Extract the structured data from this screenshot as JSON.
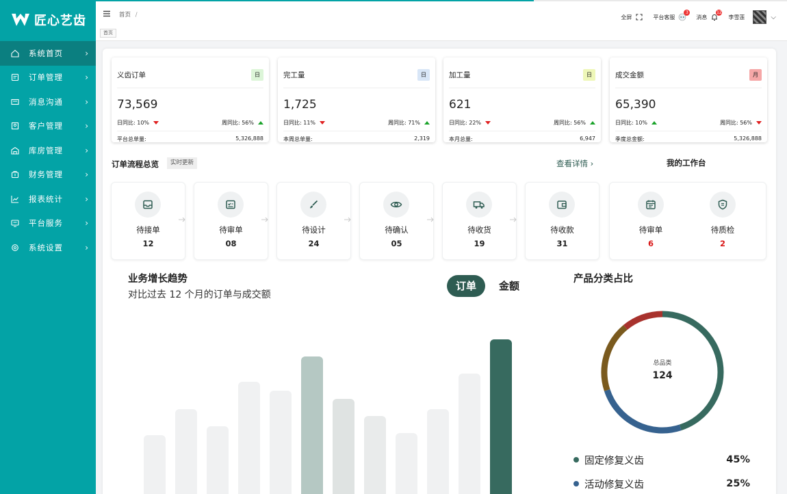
{
  "brand": {
    "name": "匠心艺齿"
  },
  "sidebar": {
    "items": [
      {
        "label": "系统首页",
        "icon": "home-icon",
        "active": true
      },
      {
        "label": "订单管理",
        "icon": "order-icon"
      },
      {
        "label": "消息沟通",
        "icon": "message-icon"
      },
      {
        "label": "客户管理",
        "icon": "customer-icon"
      },
      {
        "label": "库房管理",
        "icon": "warehouse-icon"
      },
      {
        "label": "财务管理",
        "icon": "finance-icon"
      },
      {
        "label": "报表统计",
        "icon": "report-icon"
      },
      {
        "label": "平台服务",
        "icon": "service-icon"
      },
      {
        "label": "系统设置",
        "icon": "settings-icon"
      }
    ]
  },
  "header": {
    "breadcrumb": "首页",
    "breadcrumb_sep": "/",
    "tab": "首页",
    "fullscreen": "全屏",
    "support": "平台客服",
    "support_badge": "3",
    "messages": "消息",
    "messages_badge": "12",
    "user": "李雪莲"
  },
  "stats": [
    {
      "title": "义齿订单",
      "badge": "日",
      "badge_color": "#dcf5d8",
      "value": "73,569",
      "day_label": "日同比:",
      "day_value": "10%",
      "day_trend": "down",
      "week_label": "周同比:",
      "week_value": "56%",
      "week_trend": "up",
      "foot_label": "平台总单量:",
      "foot_value": "5,326,888"
    },
    {
      "title": "完工量",
      "badge": "日",
      "badge_color": "#d8e6f7",
      "value": "1,725",
      "day_label": "日同比:",
      "day_value": "11%",
      "day_trend": "down",
      "week_label": "周同比:",
      "week_value": "71%",
      "week_trend": "up",
      "foot_label": "本周总单量:",
      "foot_value": "2,319"
    },
    {
      "title": "加工量",
      "badge": "日",
      "badge_color": "#eef7b8",
      "value": "621",
      "day_label": "日同比:",
      "day_value": "22%",
      "day_trend": "down",
      "week_label": "周同比:",
      "week_value": "56%",
      "week_trend": "up",
      "foot_label": "本月总量:",
      "foot_value": "6,947"
    },
    {
      "title": "成交金额",
      "badge": "月",
      "badge_color": "#f6a7a7",
      "value": "65,390",
      "day_label": "日同比:",
      "day_value": "10%",
      "day_trend": "up",
      "week_label": "周同比:",
      "week_value": "56%",
      "week_trend": "down",
      "foot_label": "季度总金额:",
      "foot_value": "5,326,888"
    }
  ],
  "flow": {
    "title": "订单流程总览",
    "tag": "实时更新",
    "detail_link": "查看详情 ›",
    "steps": [
      {
        "label": "待接单",
        "count": "12",
        "icon": "inbox-icon"
      },
      {
        "label": "待审单",
        "count": "08",
        "icon": "checklist-icon"
      },
      {
        "label": "待设计",
        "count": "24",
        "icon": "brush-icon"
      },
      {
        "label": "待确认",
        "count": "05",
        "icon": "eye-icon"
      },
      {
        "label": "待收货",
        "count": "19",
        "icon": "truck-icon"
      },
      {
        "label": "待收款",
        "count": "31",
        "icon": "wallet-icon"
      }
    ]
  },
  "workbench": {
    "title": "我的工作台",
    "items": [
      {
        "label": "待审单",
        "count": "6",
        "icon": "calendar-check-icon"
      },
      {
        "label": "待质检",
        "count": "2",
        "icon": "shield-icon"
      }
    ]
  },
  "trend": {
    "title": "业务增长趋势",
    "subtitle": "对比过去 12 个月的订单与成交额",
    "tab_orders": "订单",
    "tab_amount": "金额"
  },
  "chart_data": [
    {
      "type": "bar",
      "title": "业务增长趋势",
      "subtitle": "对比过去 12 个月的订单与成交额",
      "values": [
        38,
        53,
        43,
        69,
        64,
        84,
        59,
        49,
        39,
        53,
        74,
        94
      ],
      "highlight_color": "#376a5f",
      "mid_color": "#b5c8c3",
      "base_color": "#f0f1f2"
    },
    {
      "type": "pie",
      "title": "产品分类占比",
      "center_label": "总品类",
      "center_value": "124",
      "slices": [
        {
          "name": "固定修复义齿",
          "value": 45,
          "color": "#376a5f"
        },
        {
          "name": "活动修复义齿",
          "value": 25,
          "color": "#36628f"
        },
        {
          "value": 19,
          "color": "#7a5a1e"
        },
        {
          "value": 11,
          "color": "#a8322d"
        }
      ],
      "legend": [
        {
          "name": "固定修复义齿",
          "pct": "45%",
          "color": "#376a5f"
        },
        {
          "name": "活动修复义齿",
          "pct": "25%",
          "color": "#36628f"
        }
      ]
    }
  ]
}
